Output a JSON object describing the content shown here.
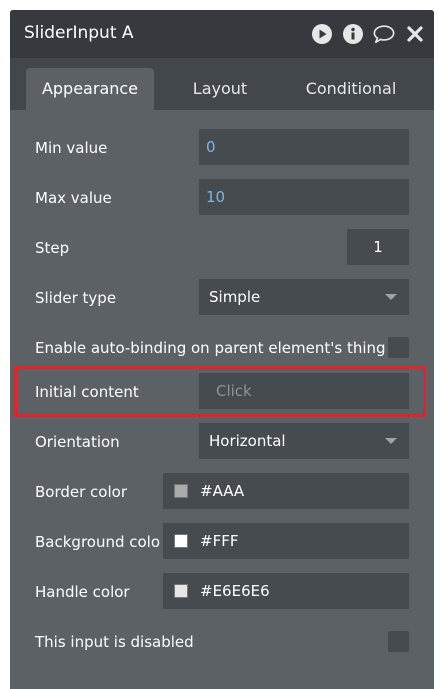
{
  "window": {
    "title": "SliderInput A",
    "icons": [
      "play-icon",
      "info-icon",
      "comment-icon",
      "close-icon"
    ]
  },
  "tabs": [
    {
      "label": "Appearance",
      "active": true
    },
    {
      "label": "Layout",
      "active": false
    },
    {
      "label": "Conditional",
      "active": false
    }
  ],
  "fields": {
    "min_value": {
      "label": "Min value",
      "value": "0"
    },
    "max_value": {
      "label": "Max value",
      "value": "10"
    },
    "step": {
      "label": "Step",
      "value": "1"
    },
    "slider_type": {
      "label": "Slider type",
      "value": "Simple"
    },
    "auto_binding": {
      "label": "Enable auto-binding on parent element's thing",
      "checked": false
    },
    "initial_content": {
      "label": "Initial content",
      "placeholder": "Click"
    },
    "orientation": {
      "label": "Orientation",
      "value": "Horizontal"
    },
    "border_color": {
      "label": "Border color",
      "value": "#AAA",
      "swatch": "#AAAAAA"
    },
    "background_color": {
      "label": "Background colo",
      "value": "#FFF",
      "swatch": "#FFFFFF"
    },
    "handle_color": {
      "label": "Handle color",
      "value": "#E6E6E6",
      "swatch": "#E6E6E6"
    },
    "disabled": {
      "label": "This input is disabled",
      "checked": false
    }
  },
  "colors": {
    "highlight": "#E3232B",
    "panel": "#5C6166",
    "title_bar": "#363A3E",
    "value_blue": "#7FB3E6"
  }
}
